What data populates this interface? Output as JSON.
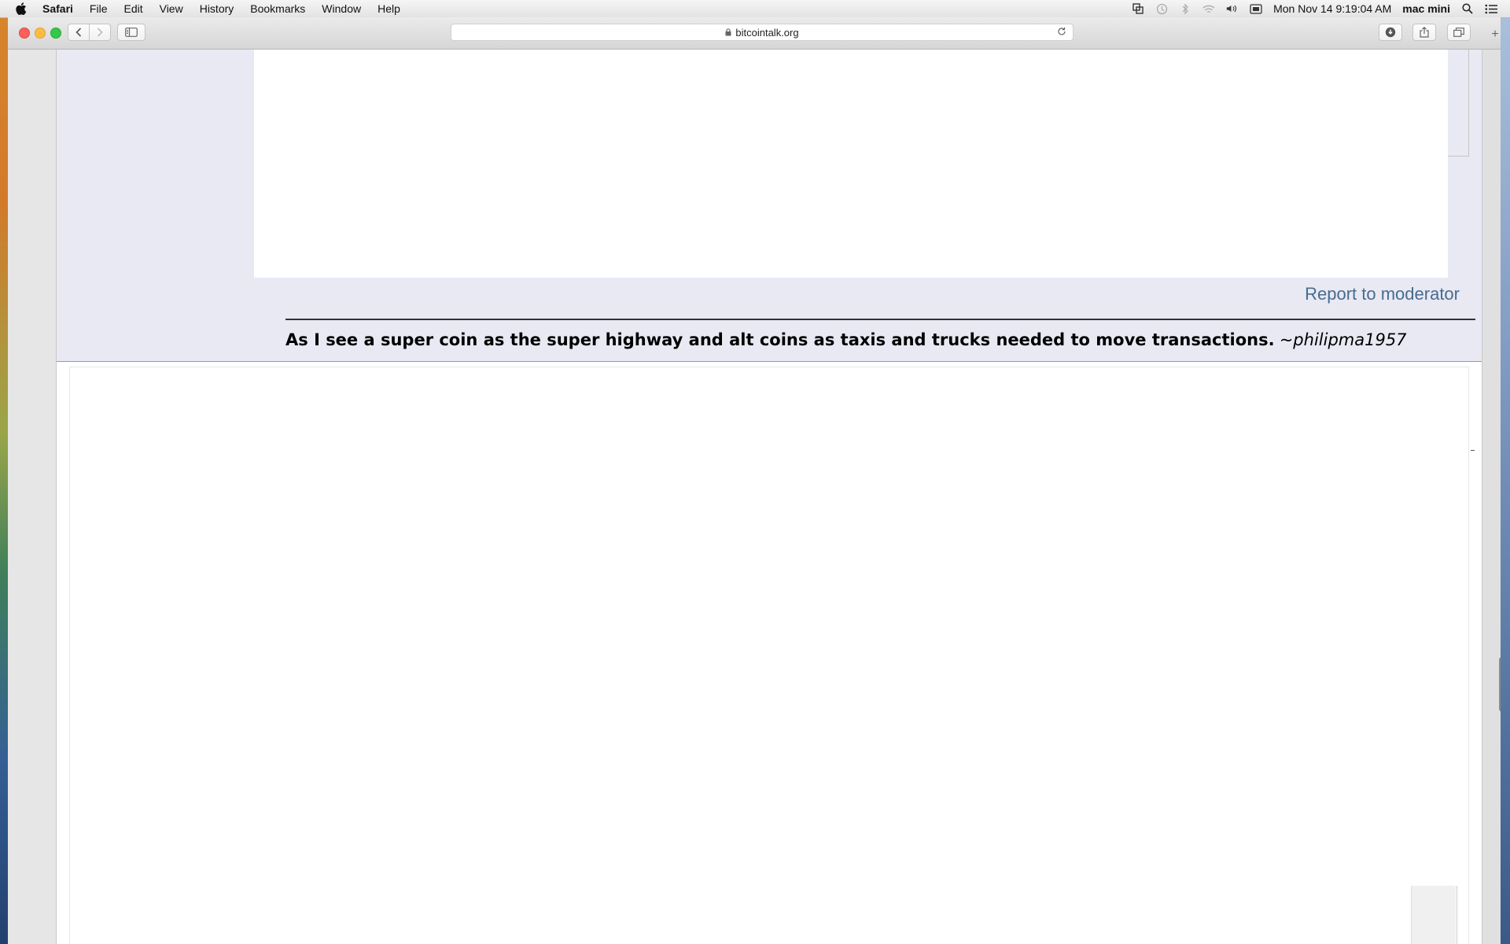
{
  "menubar": {
    "app_name": "Safari",
    "menus": [
      "File",
      "Edit",
      "View",
      "History",
      "Bookmarks",
      "Window",
      "Help"
    ],
    "clock": "Mon Nov 14  9:19:04 AM",
    "user": "mac mini"
  },
  "browser": {
    "url": "bitcointalk.org",
    "new_tab_symbol": "+"
  },
  "post": {
    "report_link": "Report to moderator",
    "signature_quote": "As I see a super coin as the super highway and alt coins as taxis and trucks needed to move transactions.",
    "signature_author": "~philipma1957"
  },
  "icons": {
    "apple": "apple-icon",
    "status": [
      "sync-icon",
      "time-machine-icon",
      "bluetooth-icon",
      "wifi-icon",
      "volume-icon",
      "display-icon"
    ],
    "search": "spotlight-icon",
    "list": "notification-center-icon"
  }
}
